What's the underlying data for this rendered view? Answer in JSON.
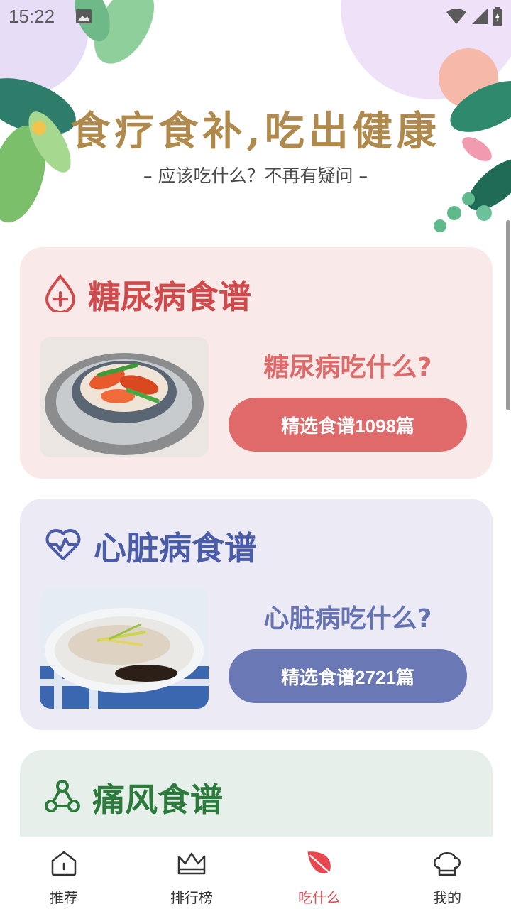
{
  "status_bar": {
    "time": "15:22",
    "icons": [
      "image-icon",
      "wifi-icon",
      "signal-icon",
      "battery-icon"
    ]
  },
  "header": {
    "headline": "食疗食补,吃出健康",
    "subline": "– 应该吃什么？不再有疑问 –"
  },
  "cards": [
    {
      "title": "糖尿病食谱",
      "icon": "blood-drop-plus-icon",
      "question": "糖尿病吃什么?",
      "button": "精选食谱1098篇",
      "accent": "#d04a4c"
    },
    {
      "title": "心脏病食谱",
      "icon": "heart-pulse-icon",
      "question": "心脏病吃什么?",
      "button": "精选食谱2721篇",
      "accent": "#4a5ca8"
    },
    {
      "title": "痛风食谱",
      "icon": "molecule-icon",
      "accent": "#2c7b3d"
    }
  ],
  "bottom_nav": [
    {
      "label": "推荐",
      "icon": "home-icon",
      "active": false
    },
    {
      "label": "排行榜",
      "icon": "crown-icon",
      "active": false
    },
    {
      "label": "吃什么",
      "icon": "leaf-icon",
      "active": true
    },
    {
      "label": "我的",
      "icon": "chef-hat-icon",
      "active": false
    }
  ]
}
